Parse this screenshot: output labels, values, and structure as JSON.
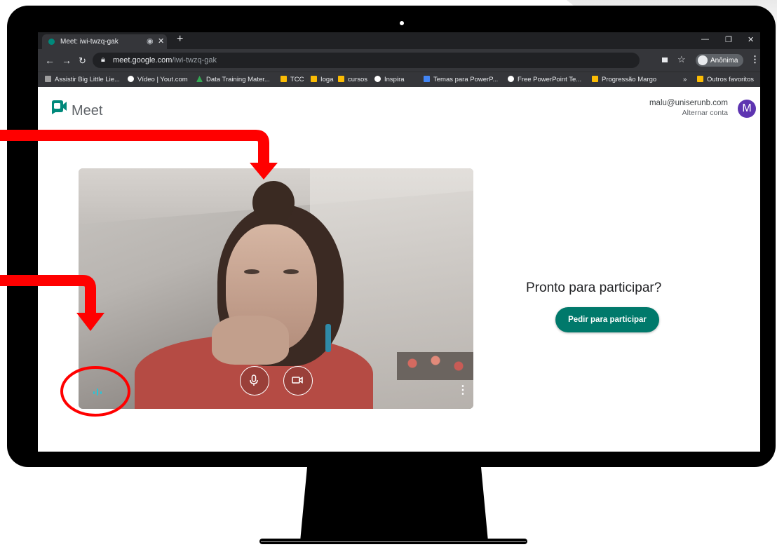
{
  "browser": {
    "tab_title": "Meet: iwi-twzq-gak",
    "url_host": "meet.google.com",
    "url_path": "/iwi-twzq-gak",
    "profile_label": "Anônima",
    "bookmarks": [
      {
        "label": "Assistir Big Little Lie...",
        "color": "#9e9e9e"
      },
      {
        "label": "Vídeo | Yout.com",
        "color": "#ffffff"
      },
      {
        "label": "Data Training Mater...",
        "color": "#34a853"
      },
      {
        "label": "TCC",
        "color": "#fbbc04"
      },
      {
        "label": "Ioga",
        "color": "#fbbc04"
      },
      {
        "label": "cursos",
        "color": "#fbbc04"
      },
      {
        "label": "Inspira",
        "color": "#ffffff"
      },
      {
        "label": "Temas para PowerP...",
        "color": "#4285f4"
      },
      {
        "label": "Free PowerPoint Te...",
        "color": "#ffffff"
      },
      {
        "label": "Progressão Margo",
        "color": "#fbbc04"
      }
    ],
    "more_bookmarks": "»",
    "other_bookmarks": "Outros favoritos"
  },
  "meet": {
    "brand": "Meet",
    "account_email": "malu@uniserunb.com",
    "switch_account": "Alternar conta",
    "avatar_letter": "M",
    "ready_text": "Pronto para participar?",
    "join_button": "Pedir para participar",
    "accent": "#00796b"
  },
  "annotations": {
    "color": "#ff0000"
  }
}
